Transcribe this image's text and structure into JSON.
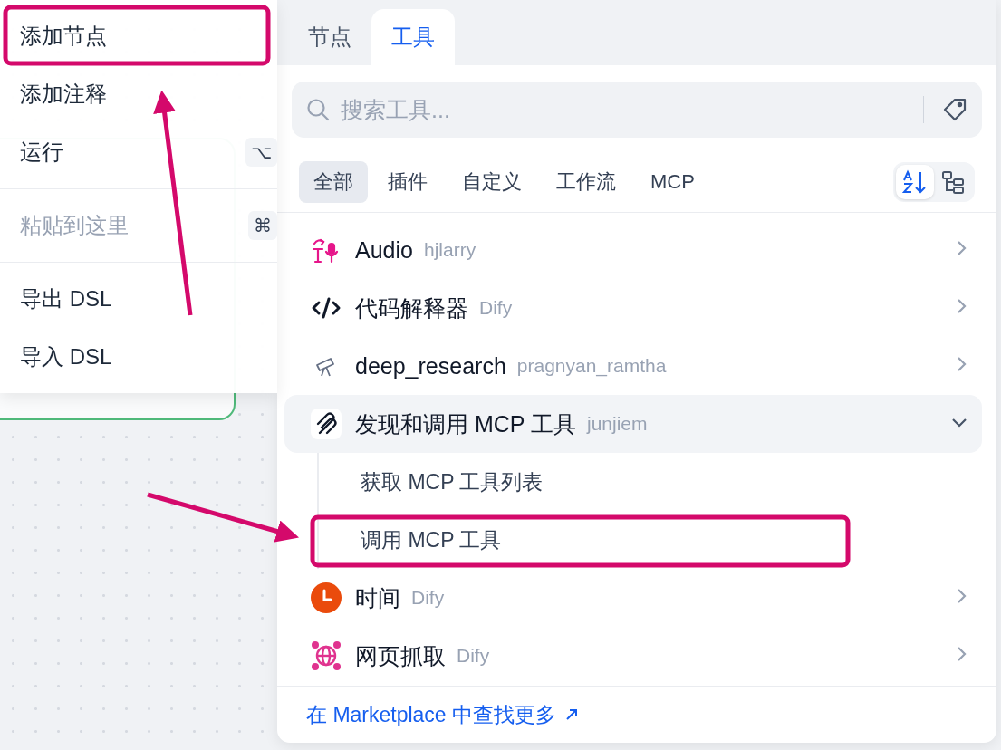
{
  "context_menu": {
    "items": [
      {
        "kind": "item",
        "label": "添加节点",
        "disabled": false
      },
      {
        "kind": "item",
        "label": "添加注释",
        "disabled": false
      },
      {
        "kind": "item",
        "label": "运行",
        "disabled": false,
        "shortcut": "⌥"
      },
      {
        "kind": "divider"
      },
      {
        "kind": "item",
        "label": "粘贴到这里",
        "disabled": true,
        "shortcut": "⌘"
      },
      {
        "kind": "divider"
      },
      {
        "kind": "item",
        "label": "导出 DSL",
        "disabled": false
      },
      {
        "kind": "item",
        "label": "导入 DSL",
        "disabled": false
      }
    ]
  },
  "tools_panel": {
    "tabs": [
      {
        "label": "节点",
        "selected": false
      },
      {
        "label": "工具",
        "selected": true
      }
    ],
    "search": {
      "placeholder": "搜索工具..."
    },
    "filters": [
      {
        "label": "全部",
        "selected": true
      },
      {
        "label": "插件",
        "selected": false
      },
      {
        "label": "自定义",
        "selected": false
      },
      {
        "label": "工作流",
        "selected": false
      },
      {
        "label": "MCP",
        "selected": false
      }
    ],
    "view_toggles": [
      {
        "kind": "alphabetical",
        "selected": true
      },
      {
        "kind": "tree",
        "selected": false
      }
    ],
    "tools": [
      {
        "name": "Audio",
        "author": "hjlarry",
        "expanded": false
      },
      {
        "name": "代码解释器",
        "author": "Dify",
        "expanded": false
      },
      {
        "name": "deep_research",
        "author": "pragnyan_ramtha",
        "expanded": false
      },
      {
        "name": "发现和调用 MCP 工具",
        "author": "junjiem",
        "expanded": true,
        "children": [
          {
            "label": "获取 MCP 工具列表"
          },
          {
            "label": "调用 MCP 工具"
          }
        ]
      },
      {
        "name": "时间",
        "author": "Dify",
        "expanded": false
      },
      {
        "name": "网页抓取",
        "author": "Dify",
        "expanded": false
      }
    ],
    "footer_link": "在 Marketplace 中查找更多"
  }
}
